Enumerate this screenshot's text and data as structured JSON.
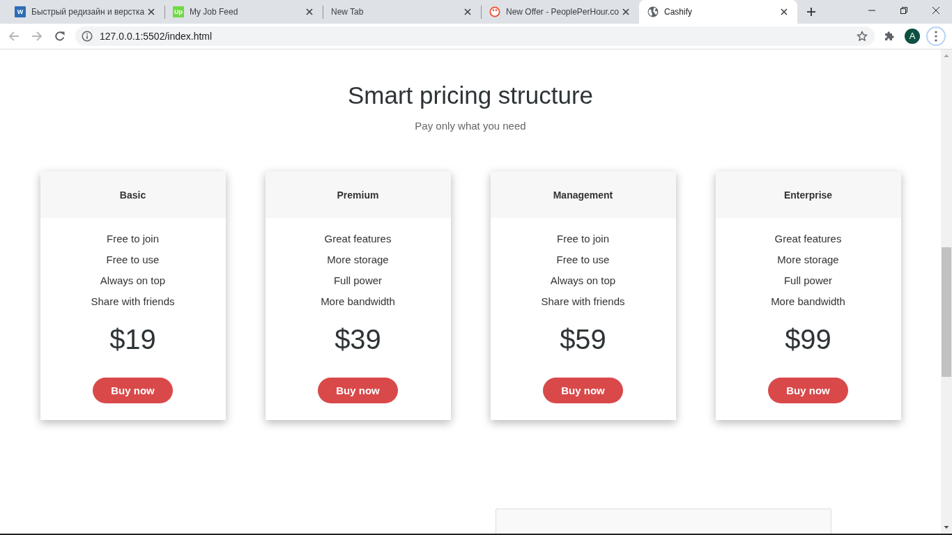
{
  "browser": {
    "tabs": [
      {
        "title": "Быстрый редизайн и верстка",
        "selected": false,
        "favicon": {
          "kind": "letter",
          "text": "W",
          "color": "#2f6db5"
        }
      },
      {
        "title": "My Job Feed",
        "selected": false,
        "favicon": {
          "kind": "letter",
          "text": "Up",
          "color": "#6fda44"
        }
      },
      {
        "title": "New Tab",
        "selected": false
      },
      {
        "title": "New Offer - PeoplePerHour.co",
        "selected": false,
        "favicon": {
          "kind": "face"
        }
      },
      {
        "title": "Cashify",
        "selected": true,
        "favicon": {
          "kind": "globe"
        }
      }
    ],
    "nav_buttons": [
      {
        "kind": "back",
        "disabled": true
      },
      {
        "kind": "forward",
        "disabled": true
      },
      {
        "kind": "reload",
        "disabled": false
      }
    ],
    "address_bar": {
      "url": "127.0.0.1:5502/index.html"
    },
    "profile": {
      "initial": "A"
    },
    "menu_button": {
      "focused": true
    }
  },
  "page": {
    "heading": "Smart pricing structure",
    "subtitle": "Pay only what you need",
    "plans": [
      {
        "name": "Basic",
        "features": [
          "Free to join",
          "Free to use",
          "Always on top",
          "Share with friends"
        ],
        "price": "$19",
        "button": "Buy now"
      },
      {
        "name": "Premium",
        "features": [
          "Great features",
          "More storage",
          "Full power",
          "More bandwidth"
        ],
        "price": "$39",
        "button": "Buy now"
      },
      {
        "name": "Management",
        "features": [
          "Free to join",
          "Free to use",
          "Always on top",
          "Share with friends"
        ],
        "price": "$59",
        "button": "Buy now"
      },
      {
        "name": "Enterprise",
        "features": [
          "Great features",
          "More storage",
          "Full power",
          "More bandwidth"
        ],
        "price": "$99",
        "button": "Buy now"
      }
    ]
  }
}
